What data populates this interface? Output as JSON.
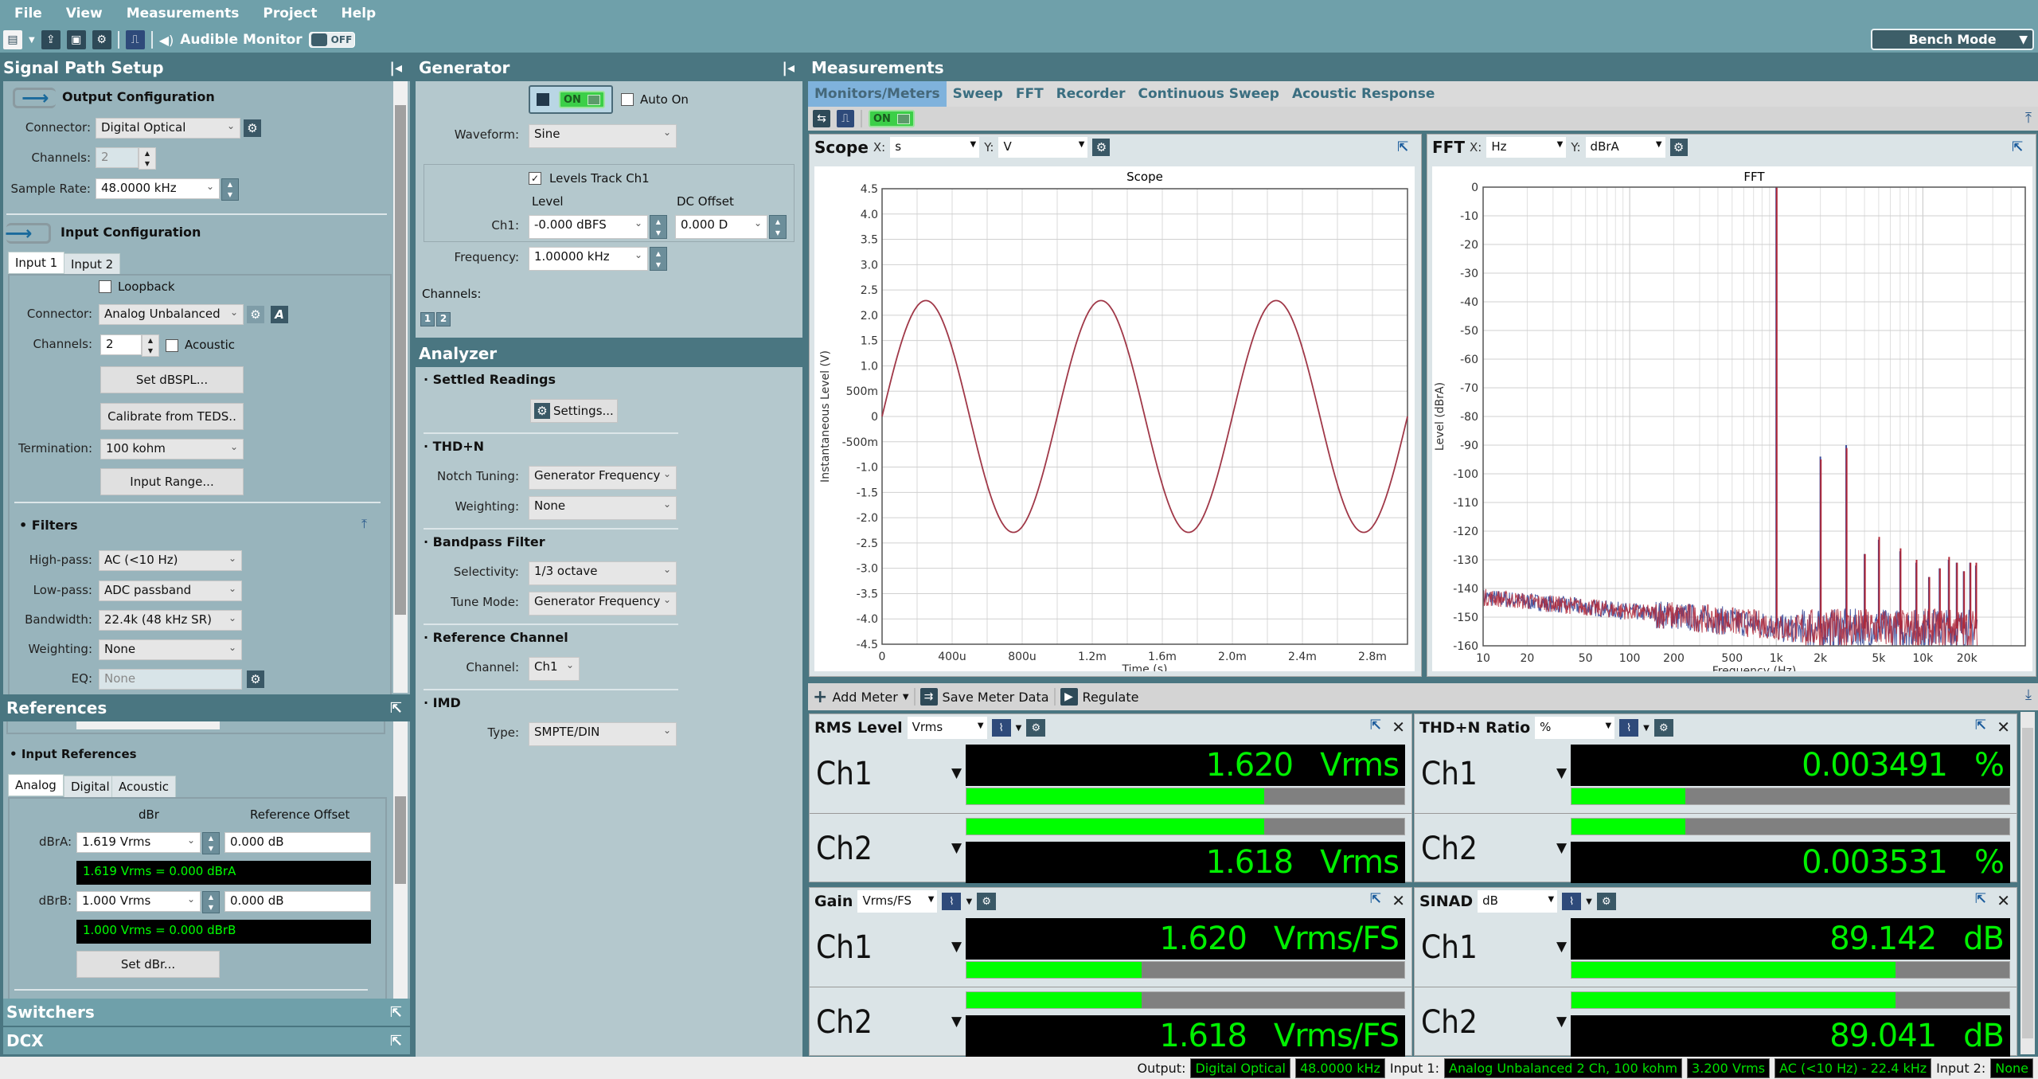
{
  "menu": [
    "File",
    "View",
    "Measurements",
    "Project",
    "Help"
  ],
  "toolbar": {
    "icons": [
      "new-document-icon",
      "open-project-icon",
      "save-icon",
      "settings-gear-icon",
      "waveform-icon",
      "speaker-icon"
    ],
    "audible_monitor_label": "Audible Monitor",
    "audible_monitor_state": "OFF",
    "mode_select": "Bench Mode"
  },
  "signal_path": {
    "title": "Signal Path Setup",
    "output": {
      "title": "Output Configuration",
      "connector_label": "Connector:",
      "connector": "Digital Optical",
      "channels_label": "Channels:",
      "channels": "2",
      "sample_rate_label": "Sample Rate:",
      "sample_rate": "48.0000 kHz"
    },
    "input": {
      "title": "Input Configuration",
      "tabs": [
        "Input 1",
        "Input 2"
      ],
      "active_tab": "Input 1",
      "loopback_label": "Loopback",
      "loopback_checked": false,
      "connector_label": "Connector:",
      "connector": "Analog Unbalanced",
      "channels_label": "Channels:",
      "channels": "2",
      "acoustic_label": "Acoustic",
      "acoustic_checked": false,
      "set_dbspl_button": "Set dBSPL...",
      "calibrate_teds_button": "Calibrate from TEDS..",
      "termination_label": "Termination:",
      "termination": "100 kohm",
      "input_range_button": "Input Range..."
    },
    "filters": {
      "title": "Filters",
      "highpass_label": "High-pass:",
      "highpass": "AC (<10 Hz)",
      "lowpass_label": "Low-pass:",
      "lowpass": "ADC passband",
      "bandwidth_label": "Bandwidth:",
      "bandwidth": "22.4k (48 kHz SR)",
      "weighting_label": "Weighting:",
      "weighting": "None",
      "eq_label": "EQ:",
      "eq": "None"
    }
  },
  "references": {
    "title": "References",
    "input_refs_title": "Input References",
    "tabs": [
      "Analog",
      "Digital",
      "Acoustic"
    ],
    "active_tab": "Analog",
    "col_dbr": "dBr",
    "col_offset": "Reference Offset",
    "dbra_label": "dBrA:",
    "dbra_value": "1.619 Vrms",
    "dbra_offset": "0.000 dB",
    "dbra_readout": "1.619 Vrms = 0.000 dBrA",
    "dbrb_label": "dBrB:",
    "dbrb_value": "1.000 Vrms",
    "dbrb_offset": "0.000 dB",
    "dbrb_readout": "1.000 Vrms = 0.000 dBrB",
    "set_dbr_button": "Set dBr..."
  },
  "switchers": {
    "title": "Switchers"
  },
  "dcx": {
    "title": "DCX"
  },
  "generator": {
    "title": "Generator",
    "state": "ON",
    "auto_on_label": "Auto On",
    "auto_on_checked": false,
    "waveform_label": "Waveform:",
    "waveform": "Sine",
    "levels_track_label": "Levels Track Ch1",
    "levels_track_checked": true,
    "level_header": "Level",
    "dc_offset_header": "DC Offset",
    "ch1_label": "Ch1:",
    "ch1_level": "-0.000 dBFS",
    "ch1_dc_offset": "0.000 D",
    "frequency_label": "Frequency:",
    "frequency": "1.00000 kHz",
    "channels_label": "Channels:",
    "channel_buttons": [
      "1",
      "2"
    ]
  },
  "analyzer": {
    "title": "Analyzer",
    "settled_title": "Settled Readings",
    "settings_button": "Settings...",
    "thdn_title": "THD+N",
    "notch_label": "Notch Tuning:",
    "notch": "Generator Frequency",
    "weighting_label": "Weighting:",
    "weighting": "None",
    "bandpass_title": "Bandpass Filter",
    "selectivity_label": "Selectivity:",
    "selectivity": "1/3 octave",
    "tune_mode_label": "Tune Mode:",
    "tune_mode": "Generator Frequency",
    "refch_title": "Reference Channel",
    "channel_label": "Channel:",
    "channel": "Ch1",
    "imd_title": "IMD",
    "type_label": "Type:",
    "type": "SMPTE/DIN"
  },
  "measurements": {
    "title": "Measurements",
    "tabs": [
      "Monitors/Meters",
      "Sweep",
      "FFT",
      "Recorder",
      "Continuous Sweep",
      "Acoustic Response"
    ],
    "active_tab": "Monitors/Meters",
    "monitor_state": "ON",
    "scope": {
      "title": "Scope",
      "x_label": "X:",
      "x_unit": "s",
      "y_label": "Y:",
      "y_unit": "V"
    },
    "fft": {
      "title": "FFT",
      "x_label": "X:",
      "x_unit": "Hz",
      "y_label": "Y:",
      "y_unit": "dBrA"
    },
    "meter_toolbar": {
      "add_meter": "Add Meter",
      "save_meter_data": "Save Meter Data",
      "regulate": "Regulate"
    },
    "meters": [
      {
        "title": "RMS Level",
        "unit_select": "Vrms",
        "channels": [
          {
            "name": "Ch1",
            "value": "1.620",
            "unit": "Vrms",
            "bar_fraction": 0.68
          },
          {
            "name": "Ch2",
            "value": "1.618",
            "unit": "Vrms",
            "bar_fraction": 0.68
          }
        ]
      },
      {
        "title": "THD+N Ratio",
        "unit_select": "%",
        "channels": [
          {
            "name": "Ch1",
            "value": "0.003491",
            "unit": "%",
            "bar_fraction": 0.26
          },
          {
            "name": "Ch2",
            "value": "0.003531",
            "unit": "%",
            "bar_fraction": 0.26
          }
        ]
      },
      {
        "title": "Gain",
        "unit_select": "Vrms/FS",
        "channels": [
          {
            "name": "Ch1",
            "value": "1.620",
            "unit": "Vrms/FS",
            "bar_fraction": 0.4
          },
          {
            "name": "Ch2",
            "value": "1.618",
            "unit": "Vrms/FS",
            "bar_fraction": 0.4
          }
        ]
      },
      {
        "title": "SINAD",
        "unit_select": "dB",
        "channels": [
          {
            "name": "Ch1",
            "value": "89.142",
            "unit": "dB",
            "bar_fraction": 0.74
          },
          {
            "name": "Ch2",
            "value": "89.041",
            "unit": "dB",
            "bar_fraction": 0.74
          }
        ]
      }
    ]
  },
  "status_bar": {
    "output_label": "Output:",
    "output_connector": "Digital Optical",
    "output_rate": "48.0000 kHz",
    "input1_label": "Input 1:",
    "input1_connector": "Analog Unbalanced 2 Ch, 100 kohm",
    "input1_range": "3.200 Vrms",
    "input1_filter": "AC (<10 Hz) - 22.4 kHz",
    "input2_label": "Input 2:",
    "input2_value": "None"
  },
  "colors": {
    "trace_ch1": "#3a4a9a",
    "trace_ch2": "#b02838",
    "scope_trace": "#a03848",
    "meter_green": "#00ff00",
    "panel_header": "#4a7681"
  },
  "chart_data": [
    {
      "type": "line",
      "title": "Scope",
      "xlabel": "Time (s)",
      "ylabel": "Instantaneous Level (V)",
      "xlim": [
        0,
        0.003
      ],
      "ylim": [
        -4.5,
        4.5
      ],
      "x_ticks": [
        0,
        0.0004,
        0.0008,
        0.0012,
        0.0016,
        0.002,
        0.0024,
        0.0028
      ],
      "x_tick_labels": [
        "0",
        "400u",
        "800u",
        "1.2m",
        "1.6m",
        "2.0m",
        "2.4m",
        "2.8m"
      ],
      "y_ticks": [
        4.5,
        4.0,
        3.5,
        3.0,
        2.5,
        2.0,
        1.5,
        1.0,
        0.5,
        0,
        -0.5,
        -1.0,
        -1.5,
        -2.0,
        -2.5,
        -3.0,
        -3.5,
        -4.0,
        -4.5
      ],
      "y_tick_labels": [
        "4.5",
        "4.0",
        "3.5",
        "3.0",
        "2.5",
        "2.0",
        "1.5",
        "1.0",
        "500m",
        "0",
        "-500m",
        "-1.0",
        "-1.5",
        "-2.0",
        "-2.5",
        "-3.0",
        "-3.5",
        "-4.0",
        "-4.5"
      ],
      "grid": true,
      "series": [
        {
          "name": "Ch1",
          "waveform": "sine",
          "frequency_hz": 1000,
          "amplitude_v": 2.29,
          "phase_deg": 0
        }
      ]
    },
    {
      "type": "line",
      "title": "FFT",
      "xlabel": "Frequency (Hz)",
      "ylabel": "Level (dBrA)",
      "x_scale": "log",
      "xlim": [
        10,
        50000
      ],
      "ylim": [
        -160,
        0
      ],
      "x_ticks": [
        10,
        20,
        50,
        100,
        200,
        500,
        1000,
        2000,
        5000,
        10000,
        20000
      ],
      "x_tick_labels": [
        "10",
        "20",
        "50",
        "100",
        "200",
        "500",
        "1k",
        "2k",
        "5k",
        "10k",
        "20k"
      ],
      "y_ticks": [
        0,
        -10,
        -20,
        -30,
        -40,
        -50,
        -60,
        -70,
        -80,
        -90,
        -100,
        -110,
        -120,
        -130,
        -140,
        -150,
        -160
      ],
      "grid": true,
      "noise_floor": {
        "start_hz": 10,
        "start_db": -143,
        "end_hz": 1000,
        "end_db": -153,
        "max_hz": 23500
      },
      "series": [
        {
          "name": "Ch1",
          "peaks": [
            [
              1000,
              0
            ],
            [
              2000,
              -94
            ],
            [
              3000,
              -90
            ],
            [
              4000,
              -128
            ],
            [
              5000,
              -123
            ],
            [
              7000,
              -127
            ],
            [
              9000,
              -131
            ],
            [
              11000,
              -136
            ],
            [
              13000,
              -133
            ],
            [
              15000,
              -130
            ],
            [
              17000,
              -131
            ],
            [
              19000,
              -134
            ],
            [
              21000,
              -131
            ],
            [
              23000,
              -132
            ]
          ]
        },
        {
          "name": "Ch2",
          "peaks": [
            [
              1000,
              0
            ],
            [
              2000,
              -95
            ],
            [
              3000,
              -91
            ],
            [
              4000,
              -128
            ],
            [
              5000,
              -122
            ],
            [
              7000,
              -126
            ],
            [
              9000,
              -130
            ],
            [
              11000,
              -136
            ],
            [
              13000,
              -133
            ],
            [
              15000,
              -129
            ],
            [
              17000,
              -131
            ],
            [
              19000,
              -134
            ],
            [
              21000,
              -131
            ],
            [
              23000,
              -131
            ]
          ]
        }
      ]
    }
  ]
}
